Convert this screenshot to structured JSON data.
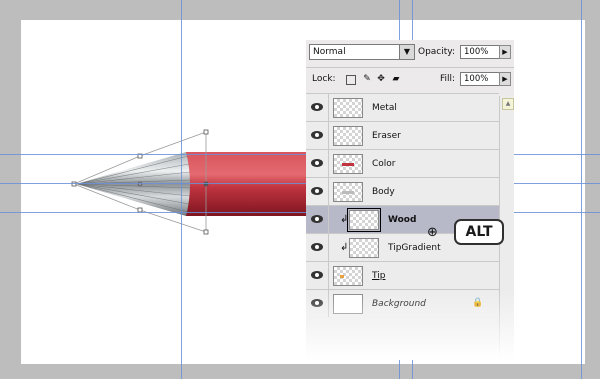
{
  "layers_panel": {
    "blend_mode": "Normal",
    "opacity_label": "Opacity:",
    "opacity_value": "100%",
    "lock_label": "Lock:",
    "fill_label": "Fill:",
    "fill_value": "100%",
    "layers": [
      {
        "name": "Metal",
        "visible": true,
        "selected": false,
        "clipped": false
      },
      {
        "name": "Eraser",
        "visible": true,
        "selected": false,
        "clipped": false
      },
      {
        "name": "Color",
        "visible": true,
        "selected": false,
        "clipped": false
      },
      {
        "name": "Body",
        "visible": true,
        "selected": false,
        "clipped": false
      },
      {
        "name": "Wood",
        "visible": true,
        "selected": true,
        "clipped": true
      },
      {
        "name": "TipGradient",
        "visible": true,
        "selected": false,
        "clipped": true
      },
      {
        "name": "Tip",
        "visible": true,
        "selected": false,
        "clipped": false
      },
      {
        "name": "Background",
        "visible": true,
        "selected": false,
        "clipped": false,
        "locked": true
      }
    ]
  },
  "overlay": {
    "key_hint": "ALT"
  },
  "icons": {
    "eye": "eye-icon",
    "lock": "lock-icon",
    "clip": "clipping-arrow-icon",
    "cursor": "clip-cursor-icon"
  },
  "colors": {
    "pencil_body": "#c0343f",
    "selection_highlight": "#b7b9c9",
    "guide": "#6c8fd8"
  }
}
